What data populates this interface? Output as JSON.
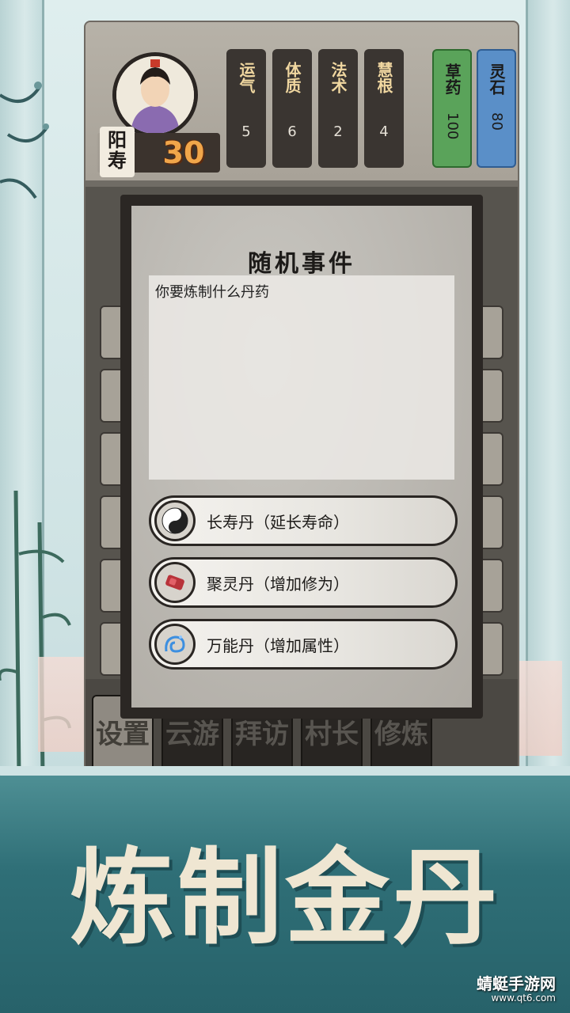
{
  "player": {
    "lifespan_label": "阳寿",
    "lifespan_value": "30"
  },
  "stats": [
    {
      "name": "运气",
      "value": "5"
    },
    {
      "name": "体质",
      "value": "6"
    },
    {
      "name": "法术",
      "value": "2"
    },
    {
      "name": "慧根",
      "value": "4"
    }
  ],
  "resources": {
    "herb": {
      "name": "草药",
      "value": "100"
    },
    "stone": {
      "name": "灵石",
      "value": "80"
    }
  },
  "modal": {
    "title": "随机事件",
    "text": "你要炼制什么丹药",
    "options": [
      {
        "label": "长寿丹（延长寿命）",
        "icon": "yin-yang-icon"
      },
      {
        "label": "聚灵丹（增加修为）",
        "icon": "red-pill-icon"
      },
      {
        "label": "万能丹（增加属性）",
        "icon": "blue-swirl-icon"
      }
    ]
  },
  "bottom_nav": [
    {
      "label": "设置"
    },
    {
      "label": "云游"
    },
    {
      "label": "拜访"
    },
    {
      "label": "村长"
    },
    {
      "label": "修炼"
    }
  ],
  "banner": {
    "title": "炼制金丹"
  },
  "watermark": {
    "text": "蜻蜓手游网",
    "url": "www.qt6.com"
  },
  "colors": {
    "accent_gold": "#f1a64a",
    "herb_green": "#5aa35a",
    "stone_blue": "#5a8fc8",
    "teal_band": "#2f6f77"
  }
}
